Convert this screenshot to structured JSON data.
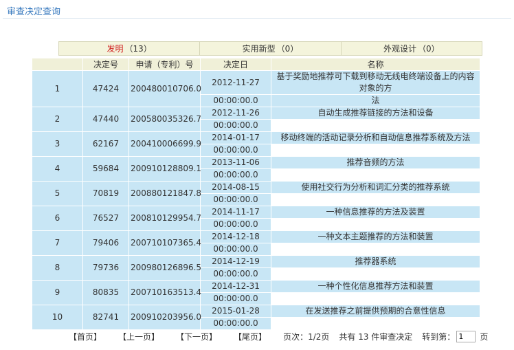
{
  "page": {
    "title": "审查决定查询"
  },
  "tabs": [
    {
      "label": "发明",
      "count": "13"
    },
    {
      "label": "实用新型",
      "count": "0"
    },
    {
      "label": "外观设计",
      "count": "0"
    }
  ],
  "table": {
    "headers": [
      "",
      "决定号",
      "申请（专利）号",
      "决定日",
      "名称"
    ],
    "rows": [
      {
        "idx": "1",
        "decision_no": "47424",
        "app_no": "200480010706.0",
        "date": "2012-11-27",
        "time": "00:00:00.0",
        "name1": "基于奖励地推荐可下载到移动无线电终端设备上的内容对象的方",
        "name2": "法"
      },
      {
        "idx": "2",
        "decision_no": "47440",
        "app_no": "200580035326.7",
        "date": "2012-11-26",
        "time": "00:00:00.0",
        "name1": "自动生成推荐链接的方法和设备",
        "name2": ""
      },
      {
        "idx": "3",
        "decision_no": "62167",
        "app_no": "200410006699.9",
        "date": "2014-01-17",
        "time": "00:00:00.0",
        "name1": "移动终端的活动记录分析和自动信息推荐系统及方法",
        "name2": ""
      },
      {
        "idx": "4",
        "decision_no": "59684",
        "app_no": "200910128809.1",
        "date": "2013-11-06",
        "time": "00:00:00.0",
        "name1": "推荐音频的方法",
        "name2": ""
      },
      {
        "idx": "5",
        "decision_no": "70819",
        "app_no": "200880121847.8",
        "date": "2014-08-15",
        "time": "00:00:00.0",
        "name1": "使用社交行为分析和词汇分类的推荐系统",
        "name2": ""
      },
      {
        "idx": "6",
        "decision_no": "76527",
        "app_no": "200810129954.7",
        "date": "2014-11-17",
        "time": "00:00:00.0",
        "name1": "一种信息推荐的方法及装置",
        "name2": ""
      },
      {
        "idx": "7",
        "decision_no": "79406",
        "app_no": "200710107365.4",
        "date": "2014-12-18",
        "time": "00:00:00.0",
        "name1": "一种文本主题推荐的方法和装置",
        "name2": ""
      },
      {
        "idx": "8",
        "decision_no": "79736",
        "app_no": "200980126896.5",
        "date": "2014-12-19",
        "time": "00:00:00.0",
        "name1": "推荐器系统",
        "name2": ""
      },
      {
        "idx": "9",
        "decision_no": "80835",
        "app_no": "200710163513.4",
        "date": "2014-12-31",
        "time": "00:00:00.0",
        "name1": "一种个性化信息推荐方法和装置",
        "name2": ""
      },
      {
        "idx": "10",
        "decision_no": "82741",
        "app_no": "200910203956.0",
        "date": "2015-01-28",
        "time": "00:00:00.0",
        "name1": "在发送推荐之前提供预期的合意性信息",
        "name2": ""
      }
    ]
  },
  "pager": {
    "first": "【首页】",
    "prev": "【上一页】",
    "next": "【下一页】",
    "last": "【尾页】",
    "page_info": "页次：1/2页",
    "total": "共有 13 件审查决定",
    "goto_label": "转到第：",
    "goto_value": "1",
    "goto_suffix": "页"
  },
  "colors": {
    "title": "#3a7bbf",
    "active_tab": "#d01f1f",
    "row_bg": "#c8e6f5",
    "header_bg": "#f0f0d8"
  }
}
